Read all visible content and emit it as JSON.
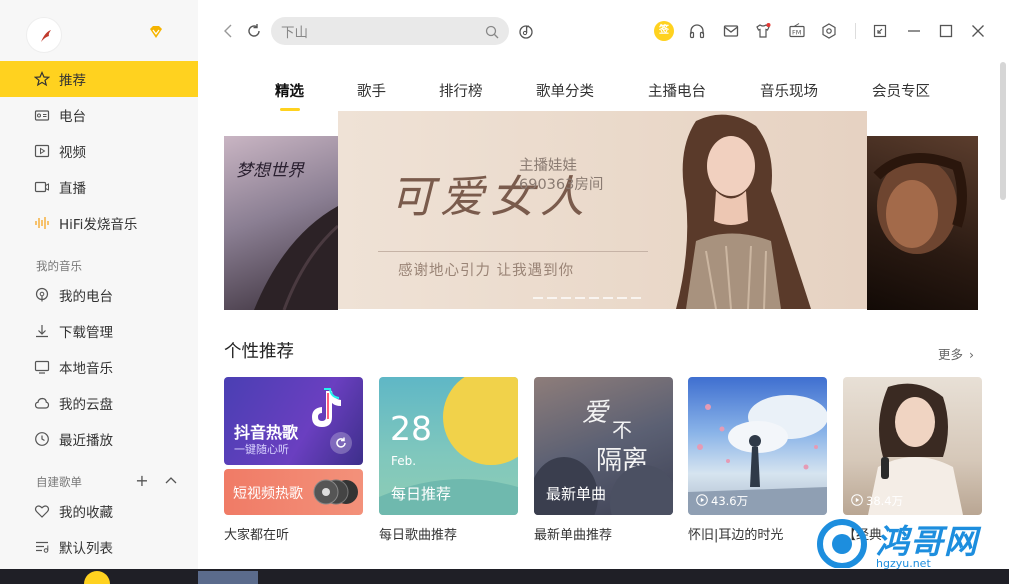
{
  "sidebar": {
    "nav": [
      {
        "label": "推荐",
        "icon": "star-icon",
        "active": true
      },
      {
        "label": "电台",
        "icon": "radio-icon"
      },
      {
        "label": "视频",
        "icon": "video-icon"
      },
      {
        "label": "直播",
        "icon": "live-camera-icon"
      },
      {
        "label": "HiFi发烧音乐",
        "icon": "hifi-wave-icon"
      }
    ],
    "my_music_label": "我的音乐",
    "my_music": [
      {
        "label": "我的电台",
        "icon": "podcast-icon"
      },
      {
        "label": "下载管理",
        "icon": "download-icon"
      },
      {
        "label": "本地音乐",
        "icon": "monitor-icon"
      },
      {
        "label": "我的云盘",
        "icon": "cloud-icon"
      },
      {
        "label": "最近播放",
        "icon": "clock-icon"
      }
    ],
    "playlists_label": "自建歌单",
    "playlists": [
      {
        "label": "我的收藏",
        "icon": "heart-icon"
      },
      {
        "label": "默认列表",
        "icon": "playlist-icon"
      }
    ]
  },
  "search": {
    "value": "下山"
  },
  "topbar": {
    "sign_label": "签"
  },
  "tabs": [
    "精选",
    "歌手",
    "排行榜",
    "歌单分类",
    "主播电台",
    "音乐现场",
    "会员专区"
  ],
  "banner": {
    "title": "可爱女人",
    "host_line1": "主播娃娃",
    "host_line2": "690363房间",
    "slogan": "感谢地心引力 让我遇到你",
    "left_title": "梦想世界"
  },
  "section": {
    "title": "个性推荐",
    "more": "更多"
  },
  "cards": {
    "douyin_title": "抖音热歌",
    "douyin_sub": "一键随心听",
    "short_video": "短视频热歌",
    "daily_day": "28",
    "daily_month": "Feb.",
    "daily_title": "每日推荐",
    "new_single": "最新单曲",
    "count4": "43.6万",
    "count5": "38.4万"
  },
  "card_labels": [
    "大家都在听",
    "每日歌曲推荐",
    "最新单曲推荐",
    "怀旧|耳边的时光",
    "【经典"
  ],
  "watermark": {
    "text": "鸿哥网",
    "sub": "hgzyu.net"
  },
  "colors": {
    "accent": "#ffd21f",
    "sidebar_bg": "#f7f7f7"
  }
}
